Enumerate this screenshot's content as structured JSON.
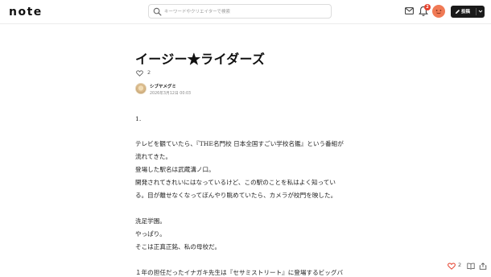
{
  "header": {
    "logo": "note",
    "search_placeholder": "キーワードやクリエイターで検索",
    "notification_count": "2",
    "post_label": "投稿"
  },
  "article": {
    "title": "イージー★ライダーズ",
    "like_count": "2",
    "author_name": "シブヤメグミ",
    "date": "2026年3月12日 00:03",
    "lines": [
      "1.",
      "",
      "テレビを観ていたら、『THE名門校 日本全国すごい学校名鑑』という番組が",
      "流れてきた。",
      "登場した駅名は武蔵溝ノ口。",
      "開発されてきれいにはなっているけど、この駅のことを私はよく知ってい",
      "る。目が離せなくなってぼんやり眺めていたら、カメラが校門を映した。",
      "",
      "洗足学園。",
      "やっぱり。",
      "そこは正真正銘、私の母校だ。",
      "",
      "１年の担任だったイナガキ先生は『セサミストリート』に登場するビッグバ"
    ]
  },
  "footer": {
    "like_count": "2"
  },
  "icons": {
    "search": "search-icon",
    "mail": "mail-icon",
    "bell": "bell-icon",
    "heart": "heart-icon",
    "book": "book-icon",
    "share": "share-icon",
    "pencil": "pencil-icon",
    "chevron": "chevron-down-icon"
  },
  "colors": {
    "badge": "#e5412d",
    "avatar": "#f07a55",
    "post_button": "#1a1a1a",
    "heart_footer": "#e5412d"
  }
}
